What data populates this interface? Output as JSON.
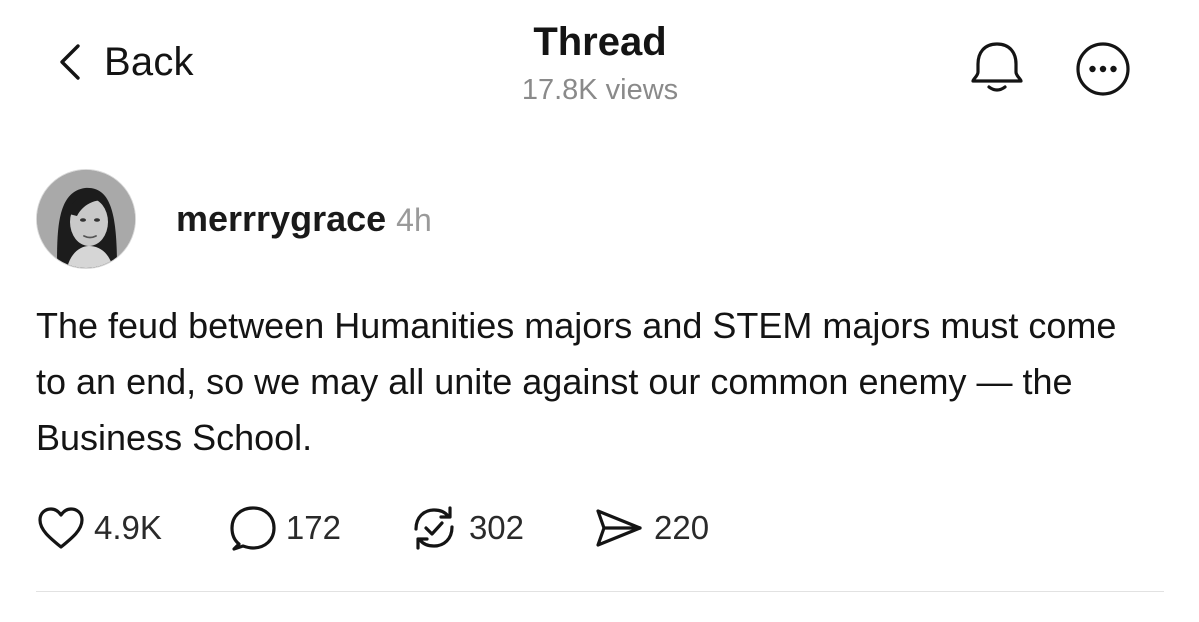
{
  "header": {
    "back_label": "Back",
    "title": "Thread",
    "views": "17.8K views",
    "icons": [
      "chevron-left-icon",
      "bell-icon",
      "more-icon"
    ]
  },
  "post": {
    "username": "merrrygrace",
    "timestamp": "4h",
    "text": "The feud between Humanities majors and STEM majors must come to an end, so we may all unite against our common enemy — the Business School.",
    "actions": {
      "likes": "4.9K",
      "replies": "172",
      "reposts": "302",
      "shares": "220"
    }
  },
  "colors": {
    "text": "#141414",
    "muted": "#8a8a8a",
    "divider": "#e2e2e2",
    "background": "#ffffff"
  }
}
